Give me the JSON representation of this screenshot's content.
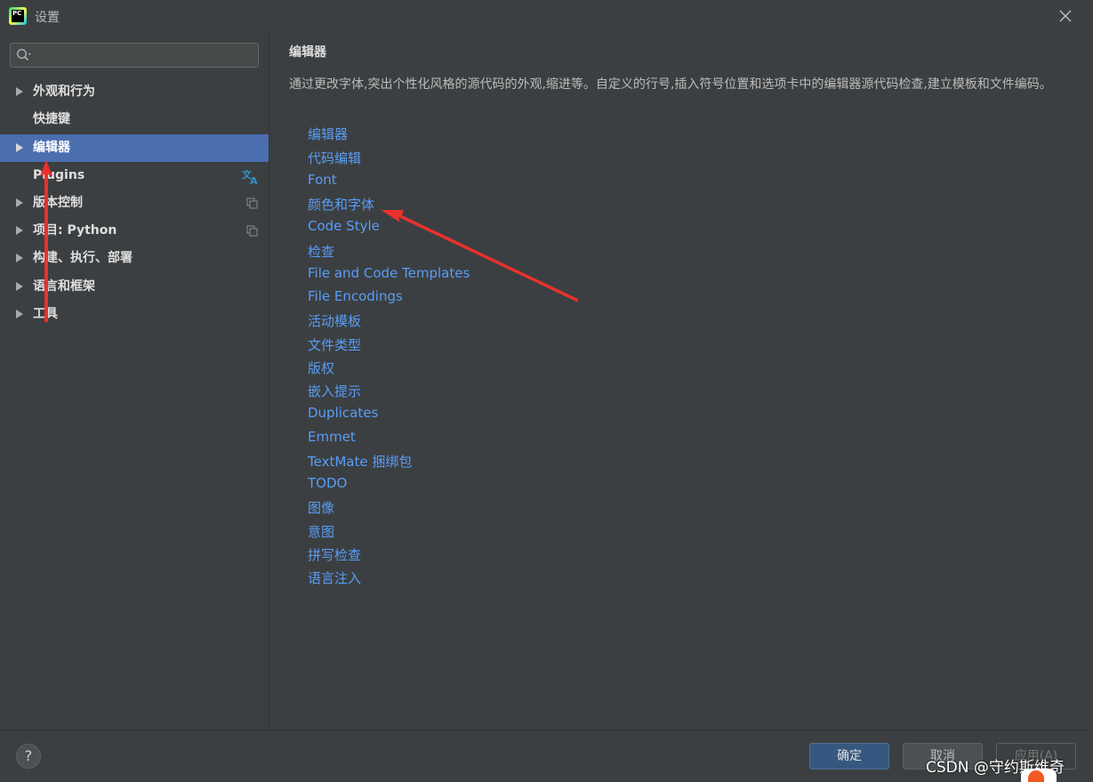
{
  "window": {
    "title": "设置",
    "app_icon_text": "PC"
  },
  "sidebar": {
    "search": {
      "value": "",
      "placeholder": ""
    },
    "items": [
      {
        "label": "外观和行为",
        "has_arrow": true,
        "selected": false
      },
      {
        "label": "快捷键",
        "has_arrow": false,
        "selected": false
      },
      {
        "label": "编辑器",
        "has_arrow": true,
        "selected": true
      },
      {
        "label": "Plugins",
        "has_arrow": false,
        "selected": false,
        "icon": "translate-icon"
      },
      {
        "label": "版本控制",
        "has_arrow": true,
        "selected": false,
        "icon": "copy-icon"
      },
      {
        "label": "项目: Python",
        "has_arrow": true,
        "selected": false,
        "icon": "copy-icon"
      },
      {
        "label": "构建、执行、部署",
        "has_arrow": true,
        "selected": false
      },
      {
        "label": "语言和框架",
        "has_arrow": true,
        "selected": false
      },
      {
        "label": "工具",
        "has_arrow": true,
        "selected": false
      }
    ]
  },
  "main": {
    "title": "编辑器",
    "description": "通过更改字体,突出个性化风格的源代码的外观,缩进等。自定义的行号,插入符号位置和选项卡中的编辑器源代码检查,建立模板和文件编码。",
    "links": [
      "编辑器",
      "代码编辑",
      "Font",
      "颜色和字体",
      "Code Style",
      "检查",
      "File and Code Templates",
      "File Encodings",
      "活动模板",
      "文件类型",
      "版权",
      "嵌入提示",
      "Duplicates",
      "Emmet",
      "TextMate 捆绑包",
      "TODO",
      "图像",
      "意图",
      "拼写检查",
      "语言注入"
    ]
  },
  "footer": {
    "help_label": "?",
    "ok_label": "确定",
    "cancel_label": "取消",
    "apply_label": "应用(A)"
  },
  "watermark": "CSDN @守约斯维奇",
  "colors": {
    "background": "#3c3f41",
    "selection": "#4b6eaf",
    "link": "#589df6",
    "annotation_arrow": "#e8312f",
    "ok_button": "#365880"
  }
}
